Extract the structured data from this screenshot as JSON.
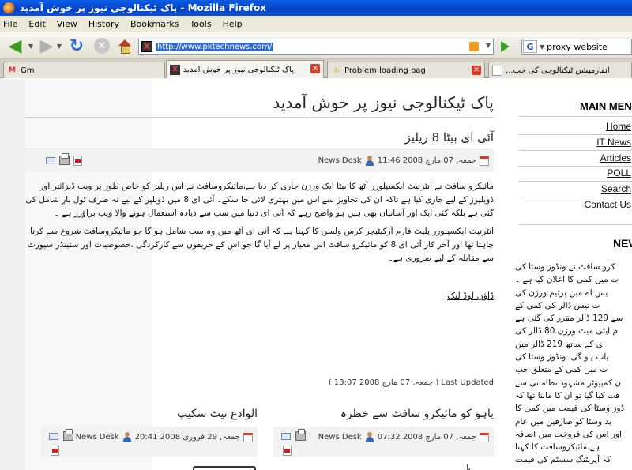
{
  "window": {
    "title": "پاک ٹیکنالوجی نیوز پر خوش آمدید - Mozilla Firefox"
  },
  "menubar": [
    "File",
    "Edit",
    "View",
    "History",
    "Bookmarks",
    "Tools",
    "Help"
  ],
  "toolbar": {
    "url": "http://www.pktechnews.com/",
    "search_engine": "G",
    "search_value": "proxy website"
  },
  "tabs": [
    {
      "label": "Gm",
      "icon": "gmail-icon",
      "active": false
    },
    {
      "label": "پاک ٹیکنالوجی نیوز پر خوش آمدید",
      "icon": "site-icon",
      "active": true
    },
    {
      "label": "Problem loading pag",
      "icon": "warning-icon",
      "active": false
    },
    {
      "label": "انفارمیشن ٹیکنالوجی کی خب...",
      "icon": "page-icon",
      "active": false
    }
  ],
  "page": {
    "title": "پاک ٹیکنالوجی نیوز پر خوش آمدید",
    "article": {
      "title": "آئی ای بیٹا 8 ریلیز",
      "author": "News Desk",
      "date": "جمعہ, 07 مارچ 2008 11:46",
      "paragraphs": [
        "مائیکرو سافٹ نے انٹرنیٹ ایکسپلورر آٹھ کا بیٹا ایک ورژن جاری کر دیا ہے،مائیکروسافٹ نے اس ریلیز کو خاص طور پر ویب ڈیزائنر اور ڈویلپرز کے لیے جاری کیا ہے تاکہ ان کی تجاویز سے اس میں بہتری لائی جا سکے۔ آئی ای 8 میں ڈویلپر کے لیے نہ صرف ٹول بار شامل کی گئی ہے بلکہ کئی ایک اور آسانیاں بھی ہیں ہو واضح رہے کہ آئی ای دنیا میں سب سے ذیادہ استعمال ہونے والا ویب براؤزر ہے ۔",
        "انٹرنیٹ ایکسپلورر پلیٹ فارم آرکیٹیچر کرس ولسن کا کہنا ہے کہ آئی ای آٹھ میں وہ سب شامل ہو گا جو مائیکروسافٹ شروع سے کرنا چاہتا تھا اور آخر کار آئی ای 8 کو مائیکرو سافٹ اس معیار پر لے آیا گا جو اس کے حریفوں سے کارکردگی ،خصوصیات اور سٹینڈر سپورٹ سے مقابلہ کے لیے ضروری ہے۔"
      ],
      "download_link": "ڈاؤن لوڈ لنک",
      "last_updated": "Last Updated ( جمعہ, 07 مارچ 2008 13:07 )"
    },
    "sub_articles": [
      {
        "title": "یاہو کو مائیکرو سافٹ سے خطرہ",
        "author": "News Desk",
        "date": "جمعہ, 07 مارچ 2008 07:32"
      },
      {
        "title": "الوادع نیٹ سکیپ",
        "author": "News Desk",
        "date": "جمعہ, 29 فروری 2008 20:41"
      }
    ],
    "fragment_text": "یا"
  },
  "sidebar": {
    "main_menu_heading": "MAIN MEN",
    "items": [
      "Home",
      "IT News",
      "Articles",
      "POLL",
      "Search",
      "Contact Us"
    ],
    "news_heading": "NEW",
    "news_lines": [
      "کرو سافٹ نے ونڈوز وسٹا کی",
      "ت میں کمی کا اعلان کیا ہے ۔",
      "یس اے میں پرئیم ورژن کی",
      "ت تیس ڈالر کی کمی کے",
      "سے 129 ڈالر مقرر کی گئی ہے",
      "م ایٹی میٹ ورژن 80 ڈالر کی",
      "ی کے ساتھ 219 ڈالر میں",
      "یاب ہو گی۔ونڈوز وسٹا کی",
      "ت میں کمی کے متعلق جب",
      "ن کمپیوٹر مشہود نظامانی سے",
      "فت کیا گیا تو ان کا ماننا تھا کہ",
      "ڈوز وسٹا کی قیمت میں کمی کا",
      "ید وسٹا کو صارفین میں عام",
      "اور اس کی فروخت میں اضافہ",
      "ہے،مائیکروسافٹ کا کہنا",
      "کہ آپریٹنگ سسٹم کی قیمت"
    ]
  },
  "colors": {
    "titlebar": "#0a53d8",
    "accent_link": "#111111"
  }
}
